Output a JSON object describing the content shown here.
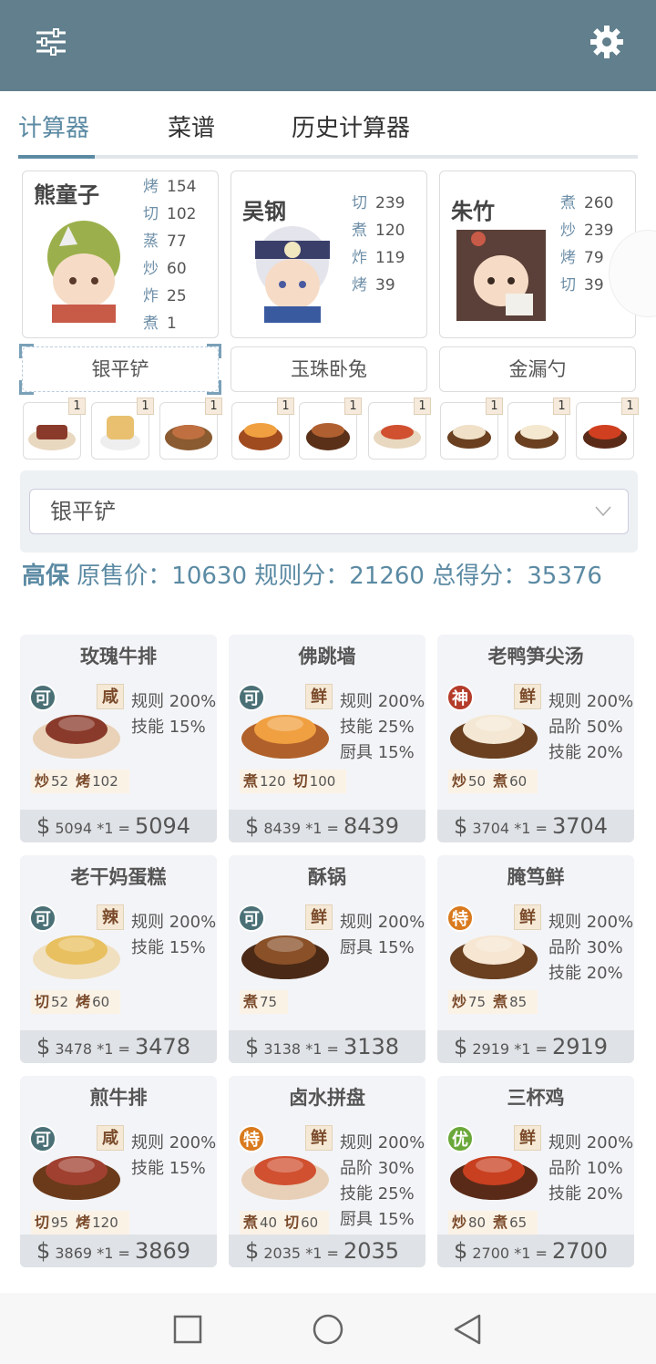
{
  "tabs": [
    "计算器",
    "菜谱",
    "历史计算器"
  ],
  "chefs": [
    {
      "name": "熊童子",
      "skills": [
        [
          "烤",
          "154"
        ],
        [
          "切",
          "102"
        ],
        [
          "蒸",
          "77"
        ],
        [
          "炒",
          "60"
        ],
        [
          "炸",
          "25"
        ],
        [
          "煮",
          "1"
        ]
      ]
    },
    {
      "name": "吴钢",
      "skills": [
        [
          "切",
          "239"
        ],
        [
          "煮",
          "120"
        ],
        [
          "炸",
          "119"
        ],
        [
          "烤",
          "39"
        ]
      ]
    },
    {
      "name": "朱竹",
      "skills": [
        [
          "煮",
          "260"
        ],
        [
          "炒",
          "239"
        ],
        [
          "烤",
          "79"
        ],
        [
          "切",
          "39"
        ]
      ]
    }
  ],
  "equipment": [
    "银平铲",
    "玉珠卧兔",
    "金漏勺"
  ],
  "dish_badge": "1",
  "select_value": "银平铲",
  "summary": {
    "label": "高保",
    "text": " 原售价：10630 规则分：21260 总得分：35376"
  },
  "dishes": [
    {
      "name": "玫瑰牛排",
      "grade": "可",
      "flavor": "咸",
      "rules": [
        "规则 200%",
        "技能 15%"
      ],
      "req": [
        [
          "炒",
          "52"
        ],
        [
          "烤",
          "102"
        ]
      ],
      "price": "5094",
      "mult": "*1",
      "total": "5094"
    },
    {
      "name": "佛跳墙",
      "grade": "可",
      "flavor": "鲜",
      "rules": [
        "规则 200%",
        "技能 25%",
        "厨具 15%"
      ],
      "req": [
        [
          "煮",
          "120"
        ],
        [
          "切",
          "100"
        ]
      ],
      "price": "8439",
      "mult": "*1",
      "total": "8439"
    },
    {
      "name": "老鸭笋尖汤",
      "grade": "神",
      "flavor": "鲜",
      "rules": [
        "规则 200%",
        "品阶 50%",
        "技能 20%"
      ],
      "req": [
        [
          "炒",
          "50"
        ],
        [
          "煮",
          "60"
        ]
      ],
      "price": "3704",
      "mult": "*1",
      "total": "3704"
    },
    {
      "name": "老干妈蛋糕",
      "grade": "可",
      "flavor": "辣",
      "rules": [
        "规则 200%",
        "技能 15%"
      ],
      "req": [
        [
          "切",
          "52"
        ],
        [
          "烤",
          "60"
        ]
      ],
      "price": "3478",
      "mult": "*1",
      "total": "3478"
    },
    {
      "name": "酥锅",
      "grade": "可",
      "flavor": "鲜",
      "rules": [
        "规则 200%",
        "厨具 15%"
      ],
      "req": [
        [
          "煮",
          "75"
        ]
      ],
      "price": "3138",
      "mult": "*1",
      "total": "3138"
    },
    {
      "name": "腌笃鲜",
      "grade": "特",
      "flavor": "鲜",
      "rules": [
        "规则 200%",
        "品阶 30%",
        "技能 20%"
      ],
      "req": [
        [
          "炒",
          "75"
        ],
        [
          "煮",
          "85"
        ]
      ],
      "price": "2919",
      "mult": "*1",
      "total": "2919"
    },
    {
      "name": "煎牛排",
      "grade": "可",
      "flavor": "咸",
      "rules": [
        "规则 200%",
        "技能 15%"
      ],
      "req": [
        [
          "切",
          "95"
        ],
        [
          "烤",
          "120"
        ]
      ],
      "price": "3869",
      "mult": "*1",
      "total": "3869"
    },
    {
      "name": "卤水拼盘",
      "grade": "特",
      "flavor": "鲜",
      "rules": [
        "规则 200%",
        "品阶 30%",
        "技能 25%",
        "厨具 15%"
      ],
      "req": [
        [
          "煮",
          "40"
        ],
        [
          "切",
          "60"
        ]
      ],
      "price": "2035",
      "mult": "*1",
      "total": "2035"
    },
    {
      "name": "三杯鸡",
      "grade": "优",
      "flavor": "鲜",
      "rules": [
        "规则 200%",
        "品阶 10%",
        "技能 20%"
      ],
      "req": [
        [
          "炒",
          "80"
        ],
        [
          "煮",
          "65"
        ]
      ],
      "price": "2700",
      "mult": "*1",
      "total": "2700"
    }
  ],
  "grade_colors": {
    "可": "#4a7076",
    "神": "#b43c2a",
    "特": "#d97a1e",
    "优": "#6aa83a"
  },
  "colors": {
    "header": "#617f8d",
    "accent": "#5b8aa3"
  }
}
